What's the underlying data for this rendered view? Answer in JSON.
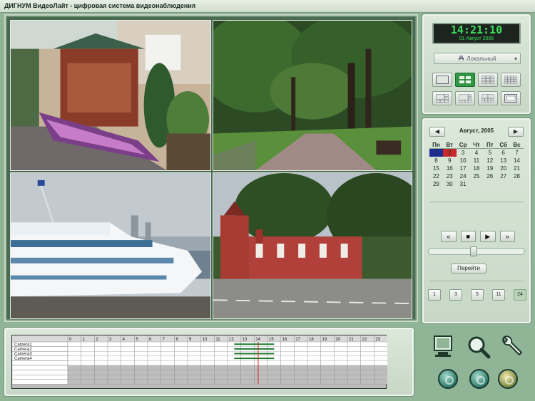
{
  "window": {
    "title": "ДИГНУМ ВидеоЛайт - цифровая система видеонаблюдения"
  },
  "clock": {
    "time": "14:21:10",
    "date": "01 Август 2005"
  },
  "source": {
    "selected": "Локальный"
  },
  "calendar": {
    "month": "Август, 2005",
    "weekdays": [
      "Пн",
      "Вт",
      "Ср",
      "Чт",
      "Пт",
      "Сб",
      "Вс"
    ],
    "days": [
      "1",
      "2",
      "3",
      "4",
      "5",
      "6",
      "7",
      "8",
      "9",
      "10",
      "11",
      "12",
      "13",
      "14",
      "15",
      "16",
      "17",
      "18",
      "19",
      "20",
      "21",
      "22",
      "23",
      "24",
      "25",
      "26",
      "27",
      "28",
      "29",
      "30",
      "31"
    ],
    "recorded_days": [
      1,
      2
    ]
  },
  "playback": {
    "buttons": [
      "«",
      "■",
      "▶",
      "»"
    ],
    "position_fraction": 0.47,
    "goto_label": "Перейти",
    "speeds": [
      "1",
      "3",
      "5",
      "11",
      "24"
    ],
    "active_speed": "24"
  },
  "timeline": {
    "cameras": [
      "Camera1",
      "Camera2",
      "Camera3",
      "Camera4"
    ],
    "hours": [
      "0",
      "1",
      "2",
      "3",
      "4",
      "5",
      "6",
      "7",
      "8",
      "9",
      "10",
      "11",
      "12",
      "13",
      "14",
      "15",
      "16",
      "17",
      "18",
      "19",
      "20",
      "21",
      "22",
      "23"
    ],
    "recordings": [
      {
        "camera": "Camera1",
        "start_hour": 12.5,
        "end_hour": 15.5
      },
      {
        "camera": "Camera2",
        "start_hour": 12.5,
        "end_hour": 15.5
      },
      {
        "camera": "Camera3",
        "start_hour": 12.5,
        "end_hour": 15.5
      },
      {
        "camera": "Camera4",
        "start_hour": 12.5,
        "end_hour": 15.5
      }
    ],
    "cursor_hour": 14.3
  },
  "colors": {
    "accent": "#2f9a44",
    "clock_text": "#3fe05c",
    "cursor": "#d32020",
    "record": "#1f7a2e"
  }
}
